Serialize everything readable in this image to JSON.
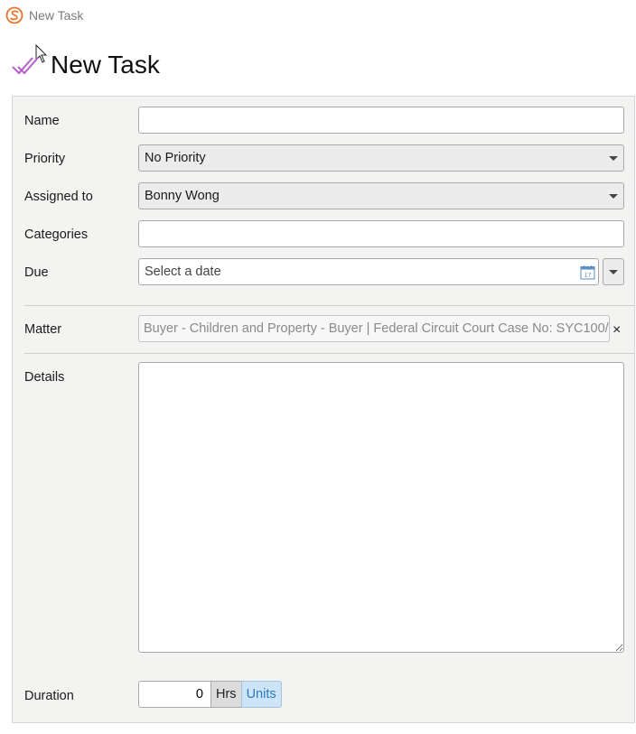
{
  "window": {
    "title": "New Task"
  },
  "header": {
    "title": "New Task"
  },
  "form": {
    "name": {
      "label": "Name",
      "value": ""
    },
    "priority": {
      "label": "Priority",
      "value": "No Priority"
    },
    "assigned_to": {
      "label": "Assigned to",
      "value": "Bonny Wong"
    },
    "categories": {
      "label": "Categories",
      "value": ""
    },
    "due": {
      "label": "Due",
      "placeholder": "Select a date",
      "calendar_day": "17"
    },
    "matter": {
      "label": "Matter",
      "value": "Buyer - Children and Property - Buyer | Federal Circuit Court Case No: SYC100/",
      "clear": "×"
    },
    "details": {
      "label": "Details",
      "value": ""
    },
    "duration": {
      "label": "Duration",
      "value": "0",
      "hrs_label": "Hrs",
      "units_label": "Units"
    }
  },
  "colors": {
    "accent": "#2a7cc4",
    "units_bg": "#cde3f6",
    "app_icon": "#e8742c",
    "task_icon": "#b45fc8"
  }
}
